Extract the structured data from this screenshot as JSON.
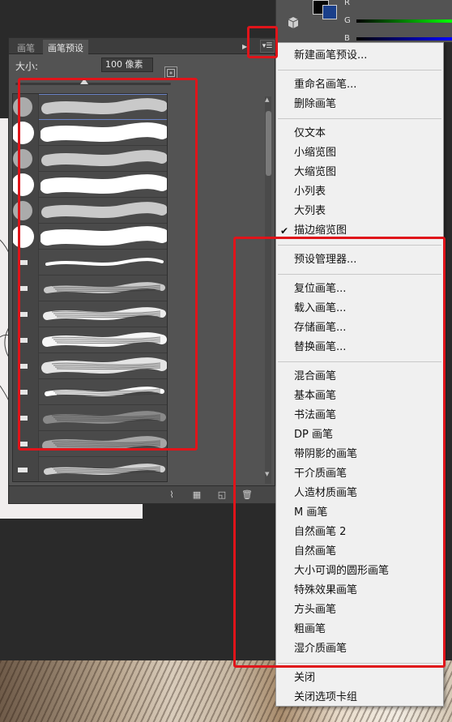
{
  "panel": {
    "tabs": [
      {
        "label": "画笔",
        "active": false
      },
      {
        "label": "画笔预设",
        "active": true
      }
    ],
    "size_label": "大小:",
    "size_value": "100 像素",
    "brush_count_visible": 15
  },
  "color_panel": {
    "channels": [
      "R",
      "G",
      "B"
    ],
    "foreground": "#050505",
    "background": "#1a3f8a"
  },
  "menu": {
    "items": [
      {
        "label": "新建画笔预设...",
        "checked": false
      },
      {
        "label": "重命名画笔...",
        "checked": false
      },
      {
        "label": "删除画笔",
        "checked": false
      },
      {
        "label": "仅文本",
        "checked": false
      },
      {
        "label": "小缩览图",
        "checked": false
      },
      {
        "label": "大缩览图",
        "checked": false
      },
      {
        "label": "小列表",
        "checked": false
      },
      {
        "label": "大列表",
        "checked": false
      },
      {
        "label": "描边缩览图",
        "checked": true
      },
      {
        "label": "预设管理器...",
        "checked": false
      },
      {
        "label": "复位画笔...",
        "checked": false
      },
      {
        "label": "载入画笔...",
        "checked": false
      },
      {
        "label": "存储画笔...",
        "checked": false
      },
      {
        "label": "替换画笔...",
        "checked": false
      },
      {
        "label": "混合画笔",
        "checked": false
      },
      {
        "label": "基本画笔",
        "checked": false
      },
      {
        "label": "书法画笔",
        "checked": false
      },
      {
        "label": "DP 画笔",
        "checked": false
      },
      {
        "label": "带阴影的画笔",
        "checked": false
      },
      {
        "label": "干介质画笔",
        "checked": false
      },
      {
        "label": "人造材质画笔",
        "checked": false
      },
      {
        "label": "M 画笔",
        "checked": false
      },
      {
        "label": "自然画笔 2",
        "checked": false
      },
      {
        "label": "自然画笔",
        "checked": false
      },
      {
        "label": "大小可调的圆形画笔",
        "checked": false
      },
      {
        "label": "特殊效果画笔",
        "checked": false
      },
      {
        "label": "方头画笔",
        "checked": false
      },
      {
        "label": "粗画笔",
        "checked": false
      },
      {
        "label": "湿介质画笔",
        "checked": false
      },
      {
        "label": "关闭",
        "checked": false
      },
      {
        "label": "关闭选项卡组",
        "checked": false
      }
    ],
    "check_glyph": "✔"
  },
  "colors": {
    "annotation_red": "#e0141a",
    "panel_bg": "#535353",
    "menu_bg": "#f0f0f0",
    "selection_outline": "#6b84c6"
  },
  "icons": {
    "panel_menu": "panel-menu-icon",
    "new_preset": "new-preset-icon",
    "footer": [
      "toggle-brush-panel-icon",
      "grid-icon",
      "new-brush-icon",
      "trash-icon"
    ]
  }
}
